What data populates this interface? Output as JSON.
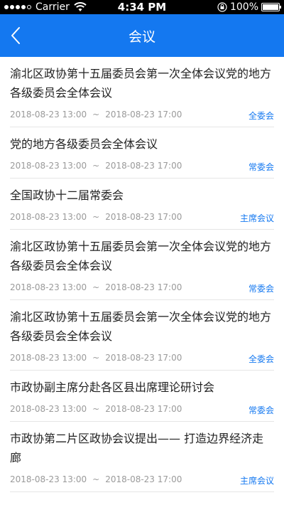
{
  "status_bar": {
    "carrier": "Carrier",
    "time": "4:34 PM",
    "battery": "100%",
    "battery_level": 1.0
  },
  "nav": {
    "title": "会议"
  },
  "meetings": [
    {
      "title": "渝北区政协第十五届委员会第一次全体会议党的地方各级委员会全体会议",
      "start": "2018-08-23 13:00",
      "sep": "~",
      "end": "2018-08-23 17:00",
      "tag": "全委会"
    },
    {
      "title": "党的地方各级委员会全体会议",
      "start": "2018-08-23 13:00",
      "sep": "~",
      "end": "2018-08-23 17:00",
      "tag": "常委会"
    },
    {
      "title": "全国政协十二届常委会",
      "start": "2018-08-23 13:00",
      "sep": "~",
      "end": "2018-08-23 17:00",
      "tag": "主席会议"
    },
    {
      "title": "渝北区政协第十五届委员会第一次全体会议党的地方各级委员会全体会议",
      "start": "2018-08-23 13:00",
      "sep": "~",
      "end": "2018-08-23 17:00",
      "tag": "常委会"
    },
    {
      "title": "渝北区政协第十五届委员会第一次全体会议党的地方各级委员会全体会议",
      "start": "2018-08-23 13:00",
      "sep": "~",
      "end": "2018-08-23 17:00",
      "tag": "全委会"
    },
    {
      "title": "市政协副主席分赴各区县出席理论研讨会",
      "start": "2018-08-23 13:00",
      "sep": "~",
      "end": "2018-08-23 17:00",
      "tag": "常委会"
    },
    {
      "title": "市政协第二片区政协会议提出—— 打造边界经济走廊",
      "start": "2018-08-23 13:00",
      "sep": "~",
      "end": "2018-08-23 17:00",
      "tag": "主席会议"
    }
  ],
  "colors": {
    "accent": "#1478f0",
    "meta": "#9a9a9a"
  }
}
